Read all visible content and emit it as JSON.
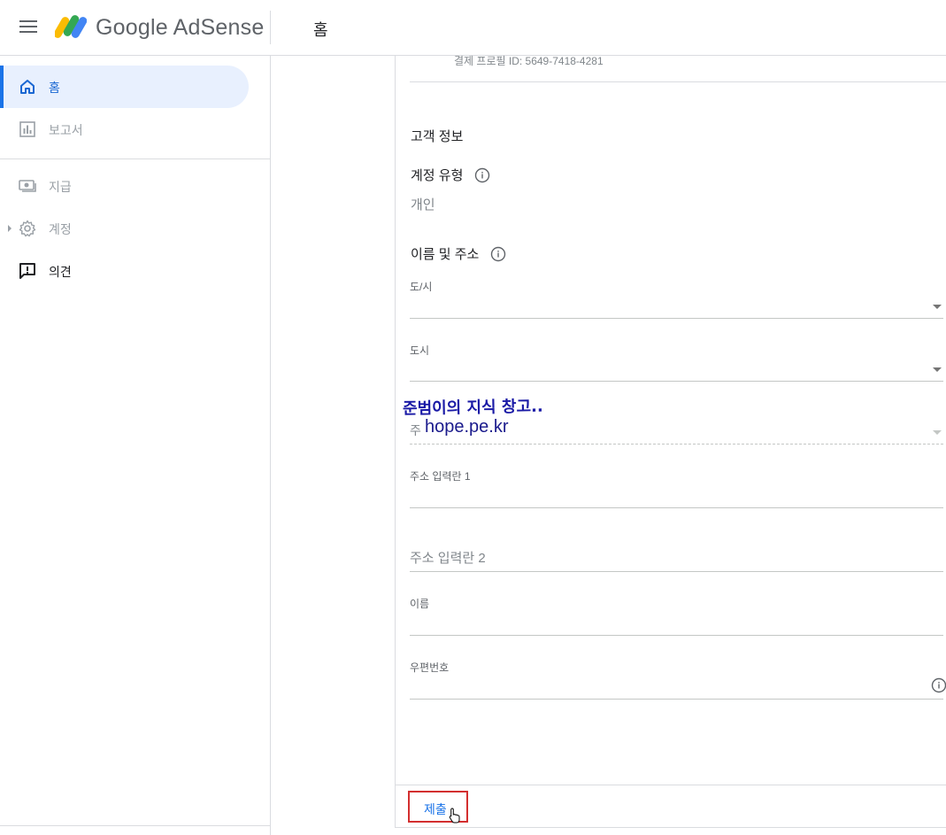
{
  "header": {
    "logo_text": "Google AdSense",
    "page_title": "홈"
  },
  "sidebar": {
    "items": [
      {
        "label": "홈",
        "icon": "home-icon"
      },
      {
        "label": "보고서",
        "icon": "bar-chart-icon"
      },
      {
        "label": "지급",
        "icon": "payments-icon"
      },
      {
        "label": "계정",
        "icon": "gear-icon"
      },
      {
        "label": "의견",
        "icon": "feedback-icon"
      }
    ]
  },
  "form": {
    "profile_id": "결제 프로필 ID: 5649-7418-4281",
    "section_title": "고객 정보",
    "account_type_label": "계정 유형",
    "account_type_value": "개인",
    "name_address_label": "이름 및 주소",
    "fields": {
      "province": "도/시",
      "city": "도시",
      "district_partial": "주",
      "address1": "주소 입력란 1",
      "address2": "주소 입력란 2",
      "name": "이름",
      "postal_code": "우편번호"
    },
    "submit_label": "제출"
  },
  "watermark": {
    "line1": "준범이의 지식 창고..",
    "line2": "hope.pe.kr"
  },
  "colors": {
    "accent": "#1a73e8",
    "active_bg": "#e8f0fe",
    "highlight_border": "#d32f2f"
  }
}
